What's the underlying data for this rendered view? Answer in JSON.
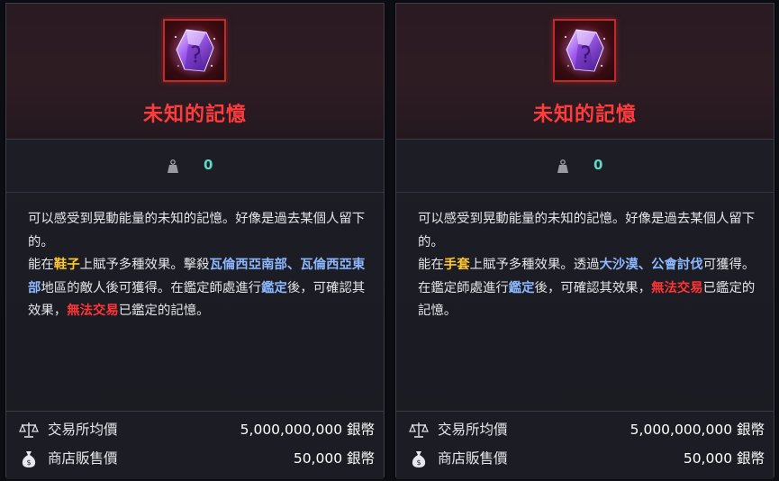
{
  "cards": [
    {
      "name": "未知的記憶",
      "weight": "0",
      "description": [
        {
          "text": "可以感受到晃動能量的未知的記憶。好像是過去某個人留下的。",
          "style": "normal",
          "newline_after": true
        },
        {
          "text": "能在",
          "style": "normal"
        },
        {
          "text": "鞋子",
          "style": "yellow"
        },
        {
          "text": "上賦予多種效果。擊殺",
          "style": "normal"
        },
        {
          "text": "瓦倫西亞南部",
          "style": "blue"
        },
        {
          "text": "、",
          "style": "blue"
        },
        {
          "text": "瓦倫西亞東部",
          "style": "blue"
        },
        {
          "text": "地區的敵人後可獲得。在",
          "style": "normal"
        },
        {
          "text": "鑑定師處進行",
          "style": "normal"
        },
        {
          "text": "鑑定",
          "style": "blue"
        },
        {
          "text": "後，可確認其效果，",
          "style": "normal"
        },
        {
          "text": "無法交易",
          "style": "red"
        },
        {
          "text": "已鑑定的記憶。",
          "style": "normal"
        }
      ],
      "prices": [
        {
          "label": "交易所均價",
          "value": "5,000,000,000 銀幣",
          "icon": "scale-icon"
        },
        {
          "label": "商店販售價",
          "value": "50,000 銀幣",
          "icon": "money-bag-icon"
        }
      ]
    },
    {
      "name": "未知的記憶",
      "weight": "0",
      "description": [
        {
          "text": "可以感受到晃動能量的未知的記憶。好像是過去某個人留下的。",
          "style": "normal",
          "newline_after": true
        },
        {
          "text": "能在",
          "style": "normal"
        },
        {
          "text": "手套",
          "style": "yellow"
        },
        {
          "text": "上賦予多種效果。透過",
          "style": "normal"
        },
        {
          "text": "大沙漠",
          "style": "blue"
        },
        {
          "text": "、",
          "style": "blue"
        },
        {
          "text": "公會討伐",
          "style": "blue"
        },
        {
          "text": "可獲得。在鑑定師處進行",
          "style": "normal"
        },
        {
          "text": "鑑定",
          "style": "blue"
        },
        {
          "text": "後，可確認其效果，",
          "style": "normal"
        },
        {
          "text": "無法交易",
          "style": "red"
        },
        {
          "text": "已鑑定的記憶。",
          "style": "normal"
        }
      ],
      "prices": [
        {
          "label": "交易所均價",
          "value": "5,000,000,000 銀幣",
          "icon": "scale-icon"
        },
        {
          "label": "商店販售價",
          "value": "50,000 銀幣",
          "icon": "money-bag-icon"
        }
      ]
    }
  ],
  "colors": {
    "item_name": "#ff3b3b",
    "weight_value": "#5fd7c9",
    "highlight_yellow": "#ffc82e",
    "highlight_blue": "#8db8ff",
    "highlight_red": "#ff3535",
    "icon_border": "#c2282c"
  }
}
